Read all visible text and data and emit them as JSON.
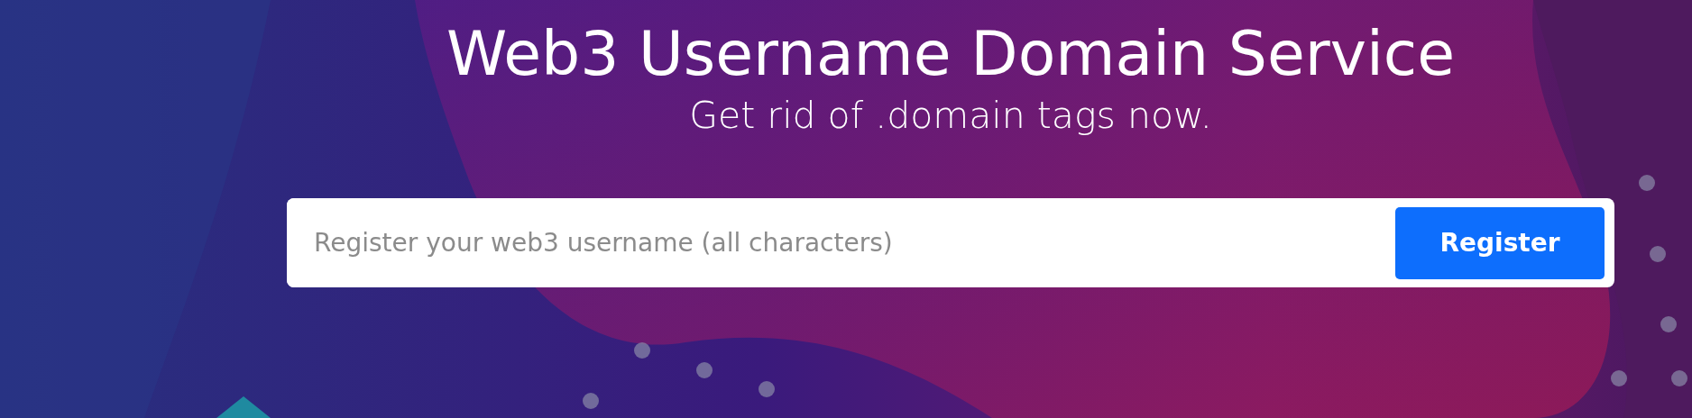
{
  "hero": {
    "title": "Web3 Username Domain Service",
    "subtitle": "Get rid of .domain tags now."
  },
  "register_form": {
    "placeholder": "Register your web3 username (all characters)",
    "button": "Register"
  }
}
